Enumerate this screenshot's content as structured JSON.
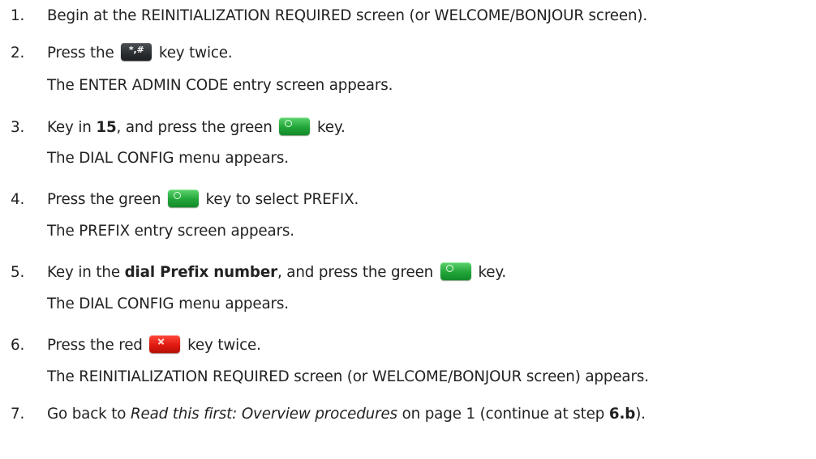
{
  "steps": [
    {
      "num": "1.",
      "text": "Begin at the REINITIALIZATION REQUIRED screen (or WELCOME/BONJOUR screen)."
    },
    {
      "num": "2.",
      "pre": "Press the",
      "post": "key twice.",
      "result": "The ENTER ADMIN CODE entry screen appears."
    },
    {
      "num": "3.",
      "pre": "Key in ",
      "bold": "15",
      "mid": ", and press the green",
      "post": "key.",
      "result": "The DIAL CONFIG menu appears."
    },
    {
      "num": "4.",
      "pre": "Press the green",
      "post": "key to select PREFIX.",
      "result": "The PREFIX entry screen appears."
    },
    {
      "num": "5.",
      "pre": "Key in the ",
      "bold": "dial Prefix number",
      "mid": ", and press the green",
      "post": "key.",
      "result": "The DIAL CONFIG menu appears."
    },
    {
      "num": "6.",
      "pre": "Press the red",
      "post": "key twice.",
      "result": "The REINITIALIZATION REQUIRED screen (or WELCOME/BONJOUR screen) appears."
    },
    {
      "num": "7.",
      "pre": "Go back to ",
      "italic": "Read this first: Overview procedures",
      "mid": " on page 1 (continue at step ",
      "bold": "6.b",
      "post": ")."
    }
  ],
  "keys": {
    "hash_key_label": "*,#",
    "hash_icon": "hash-key-icon",
    "green_icon": "green-ok-key-icon",
    "red_icon": "red-cancel-key-icon"
  }
}
